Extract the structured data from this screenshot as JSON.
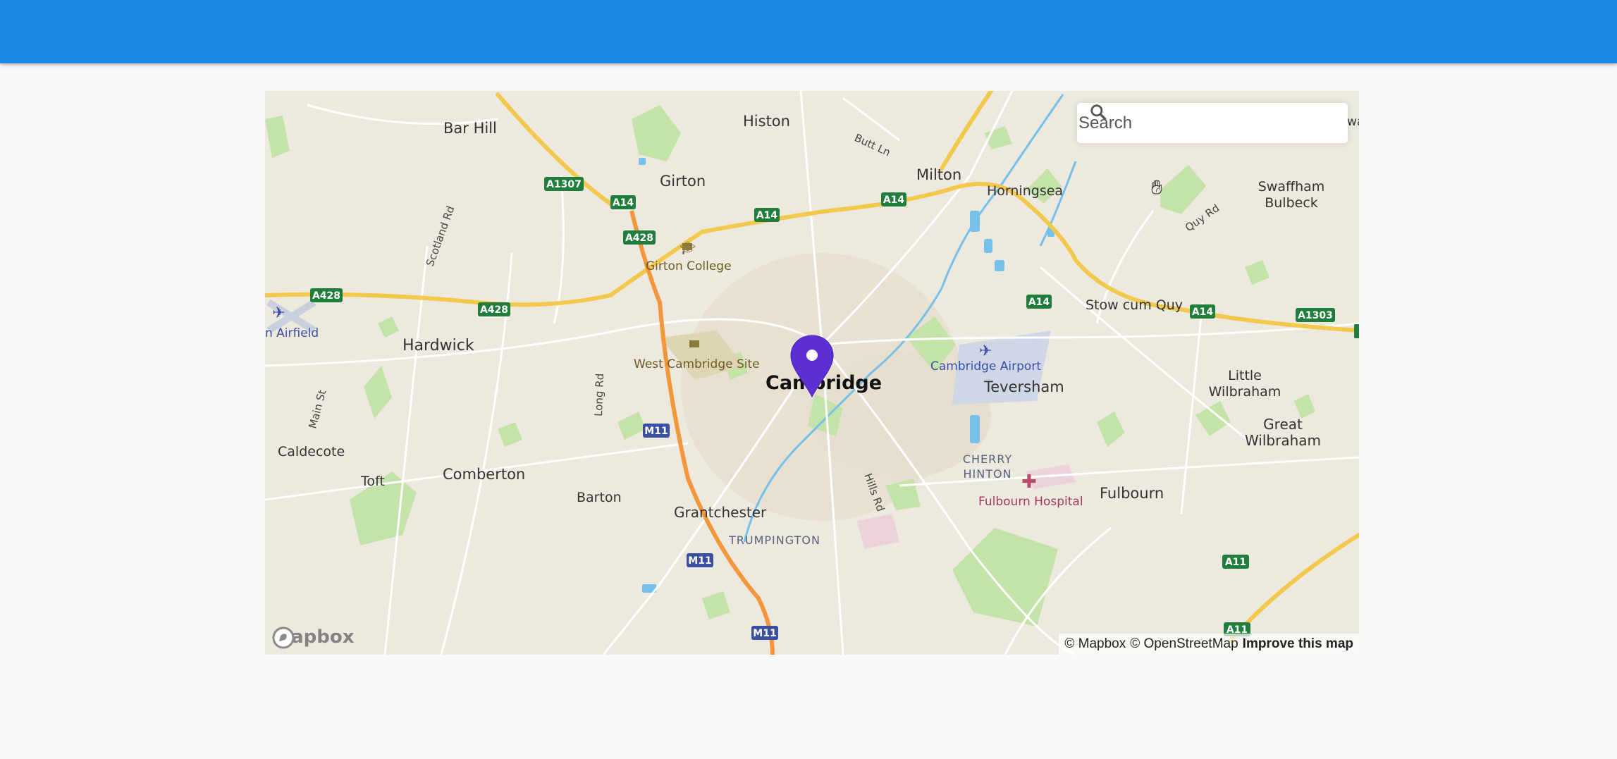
{
  "search": {
    "placeholder": "Search"
  },
  "logo": {
    "text": "mapbox"
  },
  "attribution": {
    "mapbox": "© Mapbox",
    "osm": "© OpenStreetMap",
    "improve": "Improve this map"
  },
  "marker": {
    "color": "#5b2fd1"
  },
  "places": {
    "cambridge": "Cambridge",
    "bar_hill": "Bar Hill",
    "histon": "Histon",
    "girton": "Girton",
    "milton": "Milton",
    "horningsea": "Horningsea",
    "swaffham_1": "Swaffham",
    "swaffham_2": "Bulbeck",
    "girton_college": "Girton College",
    "stow_cum_quy": "Stow cum Quy",
    "airfield": "n Airfield",
    "hardwick": "Hardwick",
    "west_cambridge": "West Cambridge Site",
    "cambridge_airport": "Cambridge Airport",
    "teversham": "Teversham",
    "little_1": "Little",
    "little_2": "Wilbraham",
    "great_1": "Great",
    "great_2": "Wilbraham",
    "caldecote": "Caldecote",
    "toft": "Toft",
    "comberton": "Comberton",
    "barton": "Barton",
    "grantchester": "Grantchester",
    "trumpington": "TRUMPINGTON",
    "cherry_1": "CHERRY",
    "cherry_2": "HINTON",
    "fulbourn_hospital": "Fulbourn Hospital",
    "fulbourn": "Fulbourn",
    "edge_wa": "wa"
  },
  "roads": {
    "butt_ln": "Butt Ln",
    "quy_rd": "Quy Rd",
    "scotland_rd": "Scotland Rd",
    "main_st": "Main St",
    "long_rd": "Long Rd",
    "hills_rd": "Hills Rd"
  },
  "shields": {
    "a1307": "A1307",
    "a14": "A14",
    "a428": "A428",
    "a1303": "A1303",
    "m11": "M11",
    "a11": "A11"
  }
}
